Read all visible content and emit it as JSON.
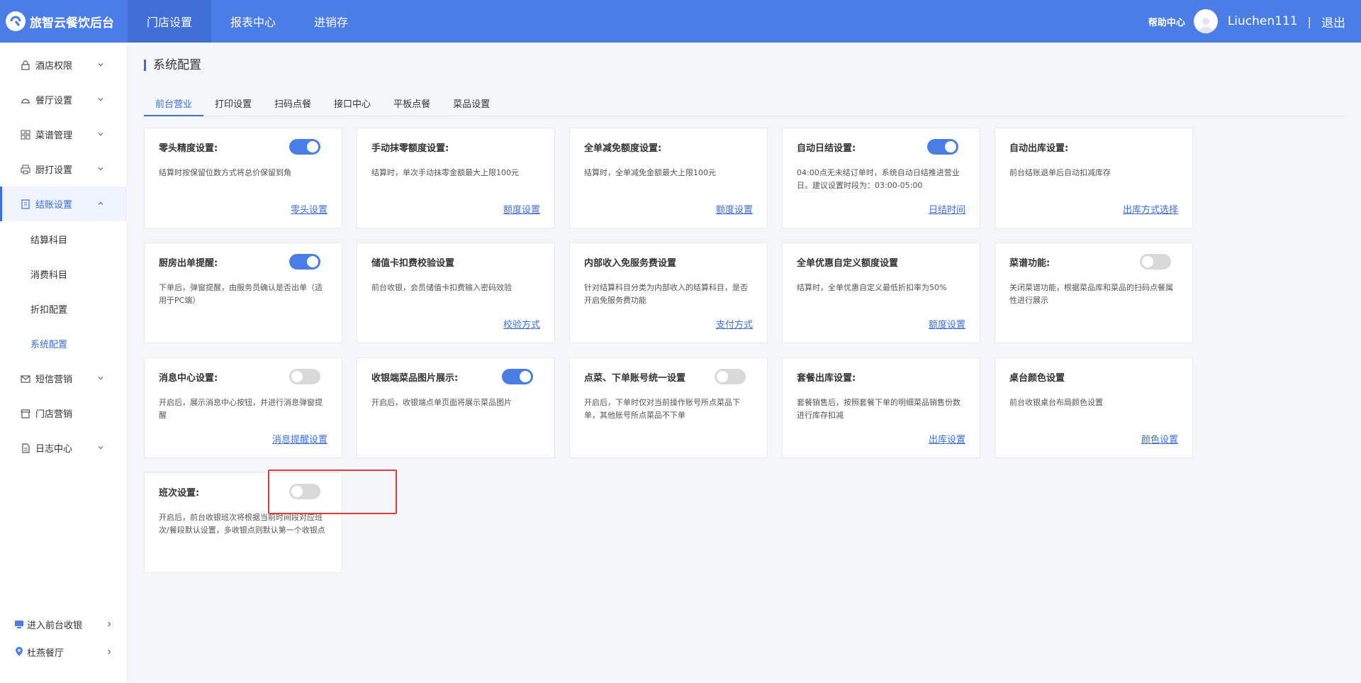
{
  "brand": {
    "name": "旅智云餐饮后台"
  },
  "nav": [
    {
      "label": "门店设置",
      "active": true
    },
    {
      "label": "报表中心",
      "active": false
    },
    {
      "label": "进销存",
      "active": false
    }
  ],
  "user": {
    "help": "帮助中心",
    "name": "Liuchen111",
    "separator": "|",
    "logout": "退出"
  },
  "sidebar": {
    "items": [
      {
        "label": "酒店权限",
        "icon": "lock-icon"
      },
      {
        "label": "餐厅设置",
        "icon": "restaurant-icon"
      },
      {
        "label": "菜谱管理",
        "icon": "grid-icon"
      },
      {
        "label": "厨打设置",
        "icon": "printer-icon"
      },
      {
        "label": "结账设置",
        "icon": "checkout-icon"
      }
    ],
    "subitems": [
      "结算科目",
      "消费科目",
      "折扣配置",
      "系统配置"
    ],
    "items2": [
      {
        "label": "短信营销",
        "icon": "mail-icon"
      },
      {
        "label": "门店营销",
        "icon": "store-icon"
      },
      {
        "label": "日志中心",
        "icon": "log-icon"
      }
    ],
    "bottom": [
      {
        "label": "进入前台收银",
        "icon": "cashier-icon"
      },
      {
        "label": "杜燕餐厅",
        "icon": "location-icon"
      }
    ]
  },
  "page": {
    "title": "系统配置"
  },
  "tabs": [
    "前台营业",
    "打印设置",
    "扫码点餐",
    "接口中心",
    "平板点餐",
    "菜品设置"
  ],
  "cards": [
    {
      "title": "零头精度设置:",
      "desc": "结算时按保留位数方式将总价保留到角",
      "link": "零头设置",
      "toggle": "on"
    },
    {
      "title": "手动抹零额度设置:",
      "desc": "结算时，单次手动抹零金额最大上限100元",
      "link": "额度设置",
      "toggle": null
    },
    {
      "title": "全单减免额度设置:",
      "desc": "结算时，全单减免金额最大上限100元",
      "link": "额度设置",
      "toggle": null
    },
    {
      "title": "自动日结设置:",
      "desc": "04:00点无未结订单时，系统自动日结推进营业日。建议设置时段为：03:00-05:00",
      "link": "日结时间",
      "toggle": "on"
    },
    {
      "title": "自动出库设置:",
      "desc": "前台结账退单后自动扣减库存",
      "link": "出库方式选择",
      "toggle": null
    },
    {
      "title": "厨房出单提醒:",
      "desc": "下单后，弹窗提醒，由服务员确认是否出单（适用于PC端）",
      "link": "",
      "toggle": "on"
    },
    {
      "title": "储值卡扣费校验设置",
      "desc": "前台收银，会员储值卡扣费输入密码效验",
      "link": "校验方式",
      "toggle": null
    },
    {
      "title": "内部收入免服务费设置",
      "desc": "针对结算科目分类为内部收入的结算科目，是否开启免服务费功能",
      "link": "支付方式",
      "toggle": null
    },
    {
      "title": "全单优惠自定义额度设置",
      "desc": "结算时，全单优惠自定义最低折扣率为50%",
      "link": "额度设置",
      "toggle": null
    },
    {
      "title": "菜谱功能:",
      "desc": "关闭菜谱功能，根据菜品库和菜品的扫码点餐属性进行展示",
      "link": "",
      "toggle": "off"
    },
    {
      "title": "消息中心设置:",
      "desc": "开启后，展示消息中心按钮，并进行消息弹窗提醒",
      "link": "消息提醒设置",
      "toggle": "off"
    },
    {
      "title": "收银端菜品图片展示:",
      "desc": "开启后，收银端点单页面将展示菜品图片",
      "link": "",
      "toggle": "on"
    },
    {
      "title": "点菜、下单账号统一设置",
      "desc": "开启后，下单时仅对当前操作账号所点菜品下单，其他账号所点菜品不下单",
      "link": "",
      "toggle": "off"
    },
    {
      "title": "套餐出库设置:",
      "desc": "套餐销售后，按照套餐下单的明细菜品销售份数进行库存扣减",
      "link": "出库设置",
      "toggle": null
    },
    {
      "title": "桌台颜色设置",
      "desc": "前台收银桌台布局颜色设置",
      "link": "颜色设置",
      "toggle": null
    },
    {
      "title": "班次设置:",
      "desc": "开启后，前台收银班次将根据当前时间段对应班次/餐段默认设置，多收银点则默认第一个收银点",
      "link": "",
      "toggle": "off"
    }
  ]
}
